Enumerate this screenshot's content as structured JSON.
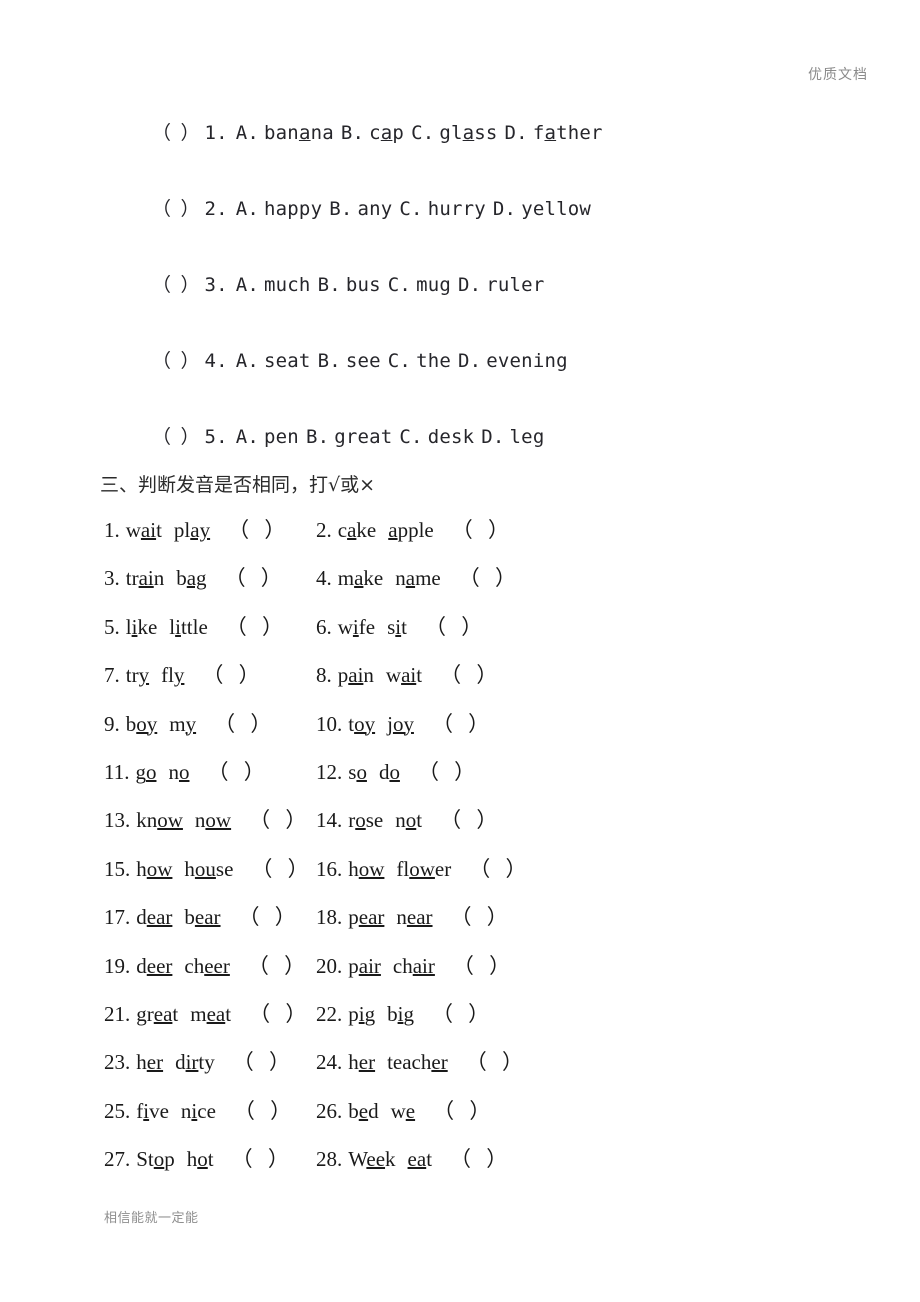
{
  "header": {
    "watermark": "优质文档"
  },
  "footer": {
    "note": "相信能就一定能"
  },
  "multiple_choice": {
    "bracket": "（ ）",
    "rows": [
      {
        "number": "1.",
        "options": [
          {
            "label": "A.",
            "pre": "ban",
            "mark": "a",
            "post": "na"
          },
          {
            "label": "B.",
            "pre": "c",
            "mark": "a",
            "post": "p"
          },
          {
            "label": "C.",
            "pre": "gl",
            "mark": "a",
            "post": "ss"
          },
          {
            "label": "D.",
            "pre": "f",
            "mark": "a",
            "post": "ther"
          }
        ]
      },
      {
        "number": "2.",
        "options": [
          {
            "label": "A.",
            "pre": "happy",
            "mark": "",
            "post": ""
          },
          {
            "label": "B.",
            "pre": "any",
            "mark": "",
            "post": ""
          },
          {
            "label": "C.",
            "pre": "hurry",
            "mark": "",
            "post": ""
          },
          {
            "label": "D.",
            "pre": "yellow",
            "mark": "",
            "post": ""
          }
        ]
      },
      {
        "number": "3.",
        "options": [
          {
            "label": "A.",
            "pre": "much",
            "mark": "",
            "post": ""
          },
          {
            "label": "B.",
            "pre": "bus",
            "mark": "",
            "post": ""
          },
          {
            "label": "C.",
            "pre": "mug",
            "mark": "",
            "post": ""
          },
          {
            "label": "D.",
            "pre": "ruler",
            "mark": "",
            "post": ""
          }
        ]
      },
      {
        "number": "4.",
        "options": [
          {
            "label": "A.",
            "pre": "seat",
            "mark": "",
            "post": ""
          },
          {
            "label": "B.",
            "pre": "see",
            "mark": "",
            "post": ""
          },
          {
            "label": "C.",
            "pre": "the",
            "mark": "",
            "post": ""
          },
          {
            "label": "D.",
            "pre": "evening",
            "mark": "",
            "post": ""
          }
        ]
      },
      {
        "number": "5.",
        "options": [
          {
            "label": "A.",
            "pre": "pen",
            "mark": "",
            "post": ""
          },
          {
            "label": "B.",
            "pre": "great",
            "mark": "",
            "post": ""
          },
          {
            "label": "C.",
            "pre": "desk",
            "mark": "",
            "post": ""
          },
          {
            "label": "D.",
            "pre": "leg",
            "mark": "",
            "post": ""
          }
        ]
      }
    ]
  },
  "section": {
    "title": "三、判断发音是否相同，打√或×",
    "answer_box": "（  ）"
  },
  "pairs": [
    {
      "number": "1.",
      "words": [
        {
          "pre": "w",
          "mark": "ai",
          "post": "t"
        },
        {
          "pre": "pl",
          "mark": "ay",
          "post": ""
        }
      ]
    },
    {
      "number": "2.",
      "words": [
        {
          "pre": "c",
          "mark": "a",
          "post": "ke"
        },
        {
          "pre": "",
          "mark": "a",
          "post": "pple"
        }
      ]
    },
    {
      "number": "3.",
      "words": [
        {
          "pre": "tr",
          "mark": "ai",
          "post": "n"
        },
        {
          "pre": "b",
          "mark": "ag",
          "post": ""
        }
      ]
    },
    {
      "number": "4.",
      "words": [
        {
          "pre": "m",
          "mark": "a",
          "post": "ke"
        },
        {
          "pre": "n",
          "mark": "a",
          "post": "me"
        }
      ]
    },
    {
      "number": "5.",
      "words": [
        {
          "pre": "l",
          "mark": "i",
          "post": "ke"
        },
        {
          "pre": "l",
          "mark": "i",
          "post": "ttle"
        }
      ]
    },
    {
      "number": "6.",
      "words": [
        {
          "pre": "w",
          "mark": "i",
          "post": "fe"
        },
        {
          "pre": "s",
          "mark": "i",
          "post": "t"
        }
      ]
    },
    {
      "number": "7.",
      "words": [
        {
          "pre": "tr",
          "mark": "y",
          "post": ""
        },
        {
          "pre": "fl",
          "mark": "y",
          "post": ""
        }
      ]
    },
    {
      "number": "8.",
      "words": [
        {
          "pre": "p",
          "mark": "ai",
          "post": "n"
        },
        {
          "pre": "w",
          "mark": "ai",
          "post": "t"
        }
      ]
    },
    {
      "number": "9.",
      "words": [
        {
          "pre": "b",
          "mark": "oy",
          "post": ""
        },
        {
          "pre": "m",
          "mark": "y",
          "post": ""
        }
      ]
    },
    {
      "number": "10.",
      "words": [
        {
          "pre": "t",
          "mark": "oy",
          "post": ""
        },
        {
          "pre": "j",
          "mark": "oy",
          "post": ""
        }
      ]
    },
    {
      "number": "11.",
      "words": [
        {
          "pre": "g",
          "mark": "o",
          "post": ""
        },
        {
          "pre": "n",
          "mark": "o",
          "post": ""
        }
      ]
    },
    {
      "number": "12.",
      "words": [
        {
          "pre": "s",
          "mark": "o",
          "post": ""
        },
        {
          "pre": "d",
          "mark": "o",
          "post": ""
        }
      ]
    },
    {
      "number": "13.",
      "words": [
        {
          "pre": "kn",
          "mark": "ow",
          "post": ""
        },
        {
          "pre": "n",
          "mark": "ow",
          "post": ""
        }
      ]
    },
    {
      "number": "14.",
      "words": [
        {
          "pre": "r",
          "mark": "o",
          "post": "se"
        },
        {
          "pre": "n",
          "mark": "o",
          "post": "t"
        }
      ]
    },
    {
      "number": "15.",
      "words": [
        {
          "pre": "h",
          "mark": "ow",
          "post": ""
        },
        {
          "pre": "h",
          "mark": "ou",
          "post": "se"
        }
      ]
    },
    {
      "number": "16.",
      "words": [
        {
          "pre": "h",
          "mark": "ow",
          "post": ""
        },
        {
          "pre": "fl",
          "mark": "ow",
          "post": "er"
        }
      ]
    },
    {
      "number": "17.",
      "words": [
        {
          "pre": "d",
          "mark": "ear",
          "post": ""
        },
        {
          "pre": "b",
          "mark": "ear",
          "post": ""
        }
      ]
    },
    {
      "number": "18.",
      "words": [
        {
          "pre": "p",
          "mark": "ear",
          "post": ""
        },
        {
          "pre": "n",
          "mark": "ear",
          "post": ""
        }
      ]
    },
    {
      "number": "19.",
      "words": [
        {
          "pre": "d",
          "mark": "eer",
          "post": ""
        },
        {
          "pre": "ch",
          "mark": "eer",
          "post": ""
        }
      ]
    },
    {
      "number": "20.",
      "words": [
        {
          "pre": "p",
          "mark": "air",
          "post": ""
        },
        {
          "pre": "ch",
          "mark": "air",
          "post": ""
        }
      ]
    },
    {
      "number": "21.",
      "words": [
        {
          "pre": "gr",
          "mark": "ea",
          "post": "t"
        },
        {
          "pre": "m",
          "mark": "ea",
          "post": "t"
        }
      ]
    },
    {
      "number": "22.",
      "words": [
        {
          "pre": "p",
          "mark": "i",
          "post": "g"
        },
        {
          "pre": "b",
          "mark": "i",
          "post": "g"
        }
      ]
    },
    {
      "number": "23.",
      "words": [
        {
          "pre": "h",
          "mark": "er",
          "post": ""
        },
        {
          "pre": "d",
          "mark": "ir",
          "post": "ty"
        }
      ]
    },
    {
      "number": "24.",
      "words": [
        {
          "pre": "h",
          "mark": "er",
          "post": ""
        },
        {
          "pre": "teach",
          "mark": "er",
          "post": ""
        }
      ]
    },
    {
      "number": "25.",
      "words": [
        {
          "pre": "f",
          "mark": "i",
          "post": "ve"
        },
        {
          "pre": "n",
          "mark": "i",
          "post": "ce"
        }
      ]
    },
    {
      "number": "26.",
      "words": [
        {
          "pre": "b",
          "mark": "e",
          "post": "d"
        },
        {
          "pre": "w",
          "mark": "e",
          "post": ""
        }
      ]
    },
    {
      "number": "27.",
      "words": [
        {
          "pre": "St",
          "mark": "o",
          "post": "p"
        },
        {
          "pre": "h",
          "mark": "o",
          "post": "t"
        }
      ]
    },
    {
      "number": "28.",
      "words": [
        {
          "pre": "W",
          "mark": "ee",
          "post": "k"
        },
        {
          "pre": "",
          "mark": "ea",
          "post": "t"
        }
      ]
    }
  ]
}
